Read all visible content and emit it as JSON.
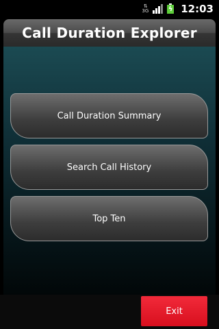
{
  "status_bar": {
    "network_label": "3G",
    "time": "12:03",
    "signal_level": 3,
    "signal_max": 4,
    "battery_color": "#5fcf3b",
    "icons": [
      "data-transfer-icon",
      "signal-strength-icon",
      "battery-charging-icon"
    ]
  },
  "app": {
    "title": "Call Duration Explorer"
  },
  "menu": {
    "items": [
      {
        "label": "Call Duration Summary"
      },
      {
        "label": "Search Call History"
      },
      {
        "label": "Top Ten"
      }
    ]
  },
  "footer": {
    "exit_label": "Exit",
    "exit_color": "#e31424"
  }
}
